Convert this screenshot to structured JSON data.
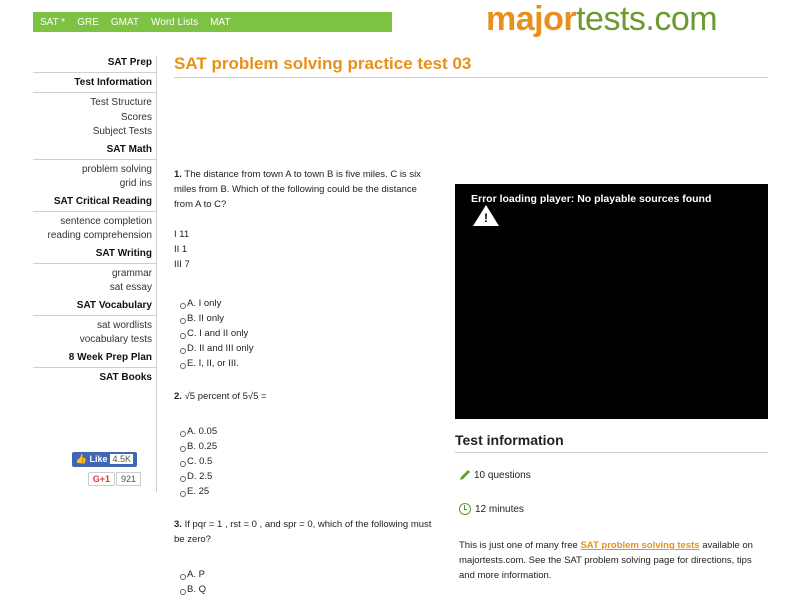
{
  "nav": {
    "items": [
      "SAT *",
      "GRE",
      "GMAT",
      "Word Lists",
      "MAT"
    ]
  },
  "logo": {
    "major": "major",
    "rest": "tests.com"
  },
  "sidebar": {
    "groups": [
      {
        "heading": "SAT Prep",
        "items": []
      },
      {
        "heading": "Test Information",
        "items": [
          "Test Structure",
          "Scores",
          "Subject Tests"
        ]
      },
      {
        "heading": "SAT Math",
        "items": [
          "problem solving",
          "grid ins"
        ]
      },
      {
        "heading": "SAT Critical Reading",
        "items": [
          "sentence completion",
          "reading comprehension"
        ]
      },
      {
        "heading": "SAT Writing",
        "items": [
          "grammar",
          "sat essay"
        ]
      },
      {
        "heading": "SAT Vocabulary",
        "items": [
          "sat wordlists",
          "vocabulary tests"
        ]
      },
      {
        "heading": "8 Week Prep Plan",
        "items": []
      },
      {
        "heading": "SAT Books",
        "items": []
      }
    ],
    "social": {
      "like_label": "Like",
      "like_count": "4.5K",
      "gplus_label": "G+1",
      "gplus_count": "921"
    }
  },
  "page": {
    "title": "SAT problem solving practice test 03"
  },
  "questions": [
    {
      "number": "1.",
      "text": "The distance from town A to town B is five miles. C is six miles from B. Which of the following could be the distance from A to C?",
      "roman": [
        "I 11",
        "II 1",
        "III 7"
      ],
      "options": [
        "A. I only",
        "B. II only",
        "C. I and II only",
        "D. II and III only",
        "E. I, II, or III."
      ]
    },
    {
      "number": "2.",
      "text": "√5 percent of 5√5 =",
      "options": [
        "A. 0.05",
        "B. 0.25",
        "C. 0.5",
        "D. 2.5",
        "E. 25"
      ]
    },
    {
      "number": "3.",
      "text": "If pqr = 1 , rst = 0 , and spr = 0, which of the following must be zero?",
      "options": [
        "A. P",
        "B. Q"
      ]
    }
  ],
  "player": {
    "error": "Error loading player: No playable sources found",
    "icon": "warning-icon"
  },
  "info": {
    "title": "Test information",
    "questions": "10 questions",
    "minutes": "12 minutes",
    "desc_pre": "This is just one of many free ",
    "desc_link": "SAT problem solving tests",
    "desc_post": " available on majortests.com. See the SAT problem solving page for directions, tips and more information."
  },
  "colors": {
    "nav_green": "#7dc242",
    "accent_orange": "#e8901c",
    "logo_green": "#6c9a2e",
    "player_bg": "#000000"
  }
}
